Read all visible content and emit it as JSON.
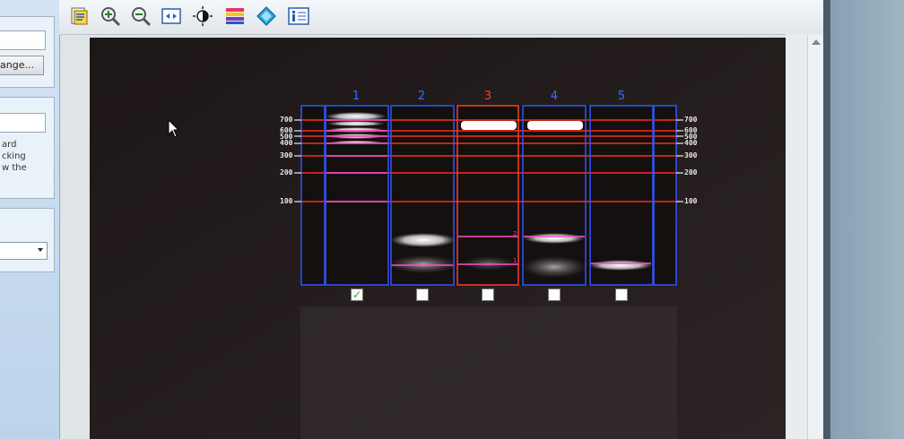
{
  "sidebar": {
    "change_button_label": "ange...",
    "text_lines": [
      "ard",
      "cking",
      "w the"
    ]
  },
  "toolbar": {
    "icons": [
      "report-icon",
      "zoom-in-icon",
      "zoom-out-icon",
      "fit-to-window-icon",
      "contrast-icon",
      "color-palette-icon",
      "paint-bucket-icon",
      "info-icon"
    ]
  },
  "gel": {
    "lanes": [
      {
        "number": "1",
        "color": "#3a6bff",
        "checked": true
      },
      {
        "number": "2",
        "color": "#3a6bff",
        "checked": false
      },
      {
        "number": "3",
        "color": "#ff3a2a",
        "checked": false
      },
      {
        "number": "4",
        "color": "#3a6bff",
        "checked": false
      },
      {
        "number": "5",
        "color": "#3a6bff",
        "checked": false
      }
    ],
    "ladder_left": [
      "700",
      "600",
      "500",
      "400",
      "300",
      "200",
      "100"
    ],
    "ladder_right": [
      "700",
      "600",
      "500",
      "400",
      "300",
      "200",
      "100"
    ],
    "band_labels": [
      "2",
      "1"
    ],
    "checkmark": "✓",
    "colors": {
      "lane_border": "#2f55ff",
      "selected_lane_border": "#ff3a2a",
      "marker_line": "#ff2a1a",
      "band_marker": "#ff4fd2",
      "background": "#241c1c"
    }
  }
}
